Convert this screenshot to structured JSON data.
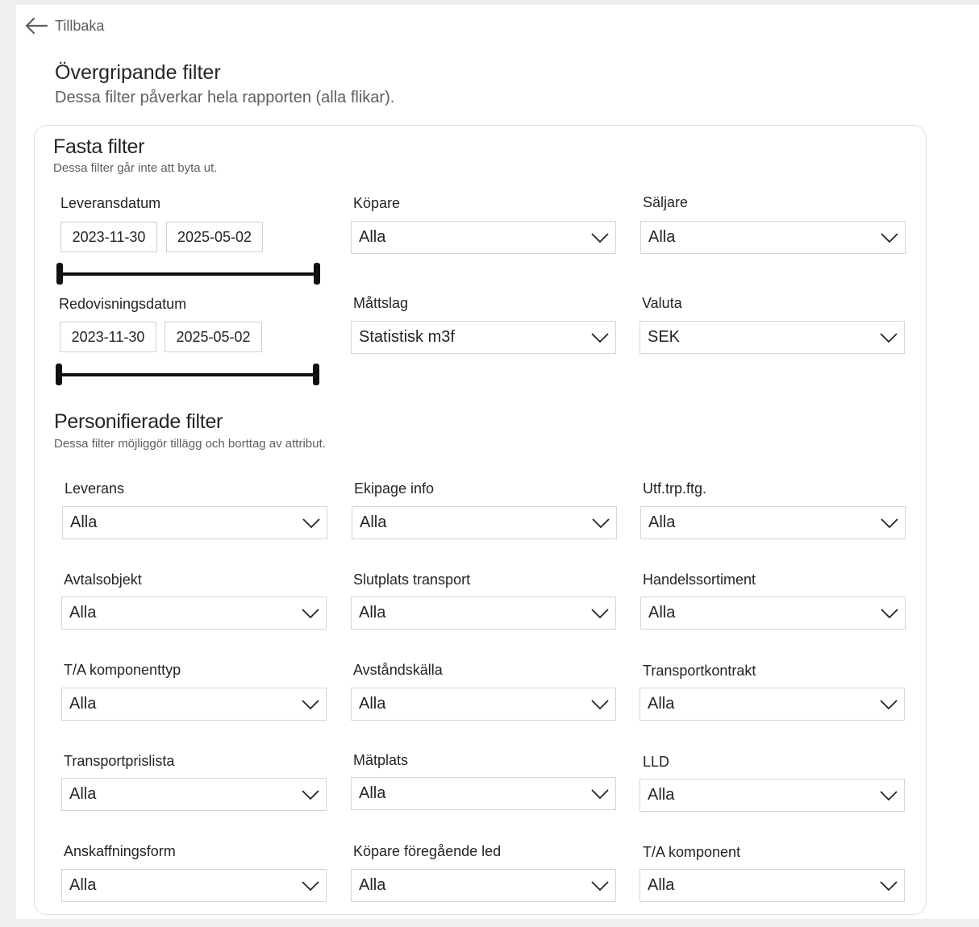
{
  "nav": {
    "back_label": "Tillbaka",
    "back_icon": "arrow-left-icon"
  },
  "header": {
    "title": "Övergripande filter",
    "subtitle": "Dessa filter påverkar hela rapporten (alla flikar)."
  },
  "fixed": {
    "title": "Fasta filter",
    "subtitle": "Dessa filter går inte att byta ut.",
    "delivery_date": {
      "label": "Leveransdatum",
      "from": "2023-11-30",
      "to": "2025-05-02",
      "range": [
        0,
        1
      ]
    },
    "accounting_date": {
      "label": "Redovisningsdatum",
      "from": "2023-11-30",
      "to": "2025-05-02",
      "range": [
        0,
        1
      ]
    },
    "dropdowns": [
      {
        "label": "Köpare",
        "value": "Alla"
      },
      {
        "label": "Säljare",
        "value": "Alla"
      },
      {
        "label": "Måttslag",
        "value": "Statistisk m3f"
      },
      {
        "label": "Valuta",
        "value": "SEK"
      }
    ]
  },
  "personal": {
    "title": "Personifierade filter",
    "subtitle": "Dessa filter möjliggör tillägg och borttag av attribut.",
    "dropdowns": [
      {
        "label": "Leverans",
        "value": "Alla"
      },
      {
        "label": "Ekipage info",
        "value": "Alla"
      },
      {
        "label": "Utf.trp.ftg.",
        "value": "Alla"
      },
      {
        "label": "Avtalsobjekt",
        "value": "Alla"
      },
      {
        "label": "Slutplats transport",
        "value": "Alla"
      },
      {
        "label": "Handelssortiment",
        "value": "Alla"
      },
      {
        "label": "T/A komponenttyp",
        "value": "Alla"
      },
      {
        "label": "Avståndskälla",
        "value": "Alla"
      },
      {
        "label": "Transportkontrakt",
        "value": "Alla"
      },
      {
        "label": "Transportprislista",
        "value": "Alla"
      },
      {
        "label": "Mätplats",
        "value": "Alla"
      },
      {
        "label": "LLD",
        "value": "Alla"
      },
      {
        "label": "Anskaffningsform",
        "value": "Alla"
      },
      {
        "label": "Köpare föregående led",
        "value": "Alla"
      },
      {
        "label": "T/A komponent",
        "value": "Alla"
      }
    ]
  },
  "icons": {
    "dropdown": "chevron-down-icon"
  }
}
